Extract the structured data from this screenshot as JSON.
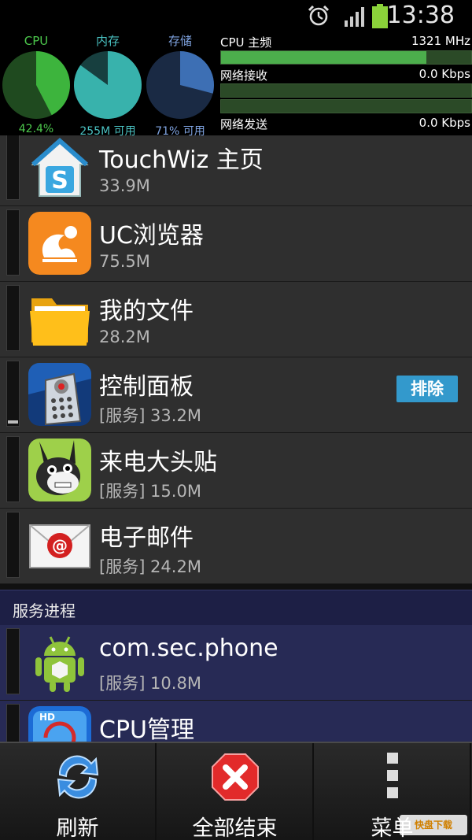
{
  "status_bar": {
    "time": "13:38",
    "icons": [
      "alarm-icon",
      "signal-icon",
      "battery-icon"
    ]
  },
  "monitor": {
    "cpu": {
      "title": "CPU",
      "value": "42.4%",
      "fraction": 0.424,
      "color": "#3db43d"
    },
    "memory": {
      "title": "内存",
      "value": "255M 可用",
      "fraction": 0.85,
      "color": "#38b2ac"
    },
    "storage": {
      "title": "存储",
      "value": "71% 可用",
      "fraction": 0.29,
      "color": "#3d6fb4"
    },
    "cpu_freq": {
      "label": "CPU 主频",
      "value": "1321 MHz",
      "fraction": 0.82
    },
    "net_recv": {
      "label": "网络接收",
      "value": "0.0 Kbps"
    },
    "net_send": {
      "label": "网络发送",
      "value": "0.0 Kbps"
    }
  },
  "apps": [
    {
      "name": "TouchWiz 主页",
      "size": "33.9M",
      "icon": "touchwiz-home-icon"
    },
    {
      "name": "UC浏览器",
      "size": "75.5M",
      "icon": "uc-browser-icon"
    },
    {
      "name": "我的文件",
      "size": "28.2M",
      "icon": "folder-icon"
    },
    {
      "name": "控制面板",
      "size": "[服务] 33.2M",
      "icon": "remote-control-icon",
      "action": "排除"
    },
    {
      "name": "来电大头贴",
      "size": "[服务] 15.0M",
      "icon": "bunny-icon"
    },
    {
      "name": "电子邮件",
      "size": "[服务] 24.2M",
      "icon": "email-icon"
    }
  ],
  "section": {
    "title": "服务进程"
  },
  "services": [
    {
      "name": "com.sec.phone",
      "size": "[服务] 10.8M",
      "icon": "android-icon"
    },
    {
      "name": "CPU管理",
      "size": "",
      "icon": "cpu-manager-icon"
    }
  ],
  "bottom_bar": {
    "refresh": "刷新",
    "kill_all": "全部结束",
    "menu": "菜单"
  },
  "watermark": "快盘下载"
}
